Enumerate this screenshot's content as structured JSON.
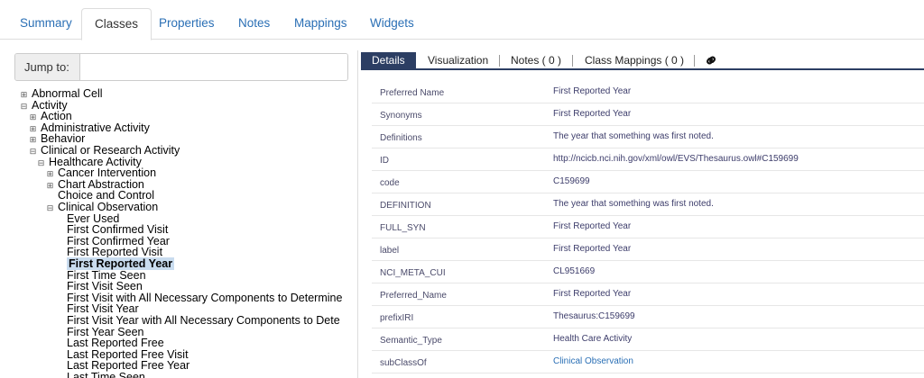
{
  "top_tabs": [
    "Summary",
    "Classes",
    "Properties",
    "Notes",
    "Mappings",
    "Widgets"
  ],
  "jump": {
    "label": "Jump to:",
    "value": ""
  },
  "tree": [
    {
      "label": "Abnormal Cell",
      "toggle": "⊞",
      "level": 0
    },
    {
      "label": "Activity",
      "toggle": "⊟",
      "level": 0
    },
    {
      "label": "Action",
      "toggle": "⊞",
      "level": 1
    },
    {
      "label": "Administrative Activity",
      "toggle": "⊞",
      "level": 1
    },
    {
      "label": "Behavior",
      "toggle": "⊞",
      "level": 1
    },
    {
      "label": "Clinical or Research Activity",
      "toggle": "⊟",
      "level": 1
    },
    {
      "label": "Healthcare Activity",
      "toggle": "⊟",
      "level": 2
    },
    {
      "label": "Cancer Intervention",
      "toggle": "⊞",
      "level": 3
    },
    {
      "label": "Chart Abstraction",
      "toggle": "⊞",
      "level": 3
    },
    {
      "label": "Choice and Control",
      "toggle": "",
      "level": 3
    },
    {
      "label": "Clinical Observation",
      "toggle": "⊟",
      "level": 3
    },
    {
      "label": "Ever Used",
      "toggle": "",
      "level": 4
    },
    {
      "label": "First Confirmed Visit",
      "toggle": "",
      "level": 4
    },
    {
      "label": "First Confirmed Year",
      "toggle": "",
      "level": 4
    },
    {
      "label": "First Reported Visit",
      "toggle": "",
      "level": 4
    },
    {
      "label": "First Reported Year",
      "toggle": "",
      "level": 4,
      "selected": true
    },
    {
      "label": "First Time Seen",
      "toggle": "",
      "level": 4
    },
    {
      "label": "First Visit Seen",
      "toggle": "",
      "level": 4
    },
    {
      "label": "First Visit with All Necessary Components to Determine",
      "toggle": "",
      "level": 4
    },
    {
      "label": "First Visit Year",
      "toggle": "",
      "level": 4
    },
    {
      "label": "First Visit Year with All Necessary Components to Dete",
      "toggle": "",
      "level": 4
    },
    {
      "label": "First Year Seen",
      "toggle": "",
      "level": 4
    },
    {
      "label": "Last Reported Free",
      "toggle": "",
      "level": 4
    },
    {
      "label": "Last Reported Free Visit",
      "toggle": "",
      "level": 4
    },
    {
      "label": "Last Reported Free Year",
      "toggle": "",
      "level": 4
    },
    {
      "label": "Last Time Seen",
      "toggle": "",
      "level": 4
    }
  ],
  "detail_tabs": [
    "Details",
    "Visualization",
    "Notes ( 0 )",
    "Class Mappings ( 0 )"
  ],
  "link_icon": "link-icon",
  "details": [
    {
      "key": "Preferred Name",
      "value": "First Reported Year"
    },
    {
      "key": "Synonyms",
      "value": "First Reported Year"
    },
    {
      "key": "Definitions",
      "value": "The year that something was first noted."
    },
    {
      "key": "ID",
      "value": "http://ncicb.nci.nih.gov/xml/owl/EVS/Thesaurus.owl#C159699"
    },
    {
      "key": "code",
      "value": "C159699"
    },
    {
      "key": "DEFINITION",
      "value": "The year that something was first noted."
    },
    {
      "key": "FULL_SYN",
      "value": "First Reported Year"
    },
    {
      "key": "label",
      "value": "First Reported Year"
    },
    {
      "key": "NCI_META_CUI",
      "value": "CL951669"
    },
    {
      "key": "Preferred_Name",
      "value": "First Reported Year"
    },
    {
      "key": "prefixIRI",
      "value": "Thesaurus:C159699"
    },
    {
      "key": "Semantic_Type",
      "value": "Health Care Activity"
    },
    {
      "key": "subClassOf",
      "value": "Clinical Observation",
      "link": true
    }
  ],
  "colors": {
    "link": "#2a6fb5",
    "tab_active": "#2c3e63",
    "selected_bg": "#c9dcef"
  }
}
